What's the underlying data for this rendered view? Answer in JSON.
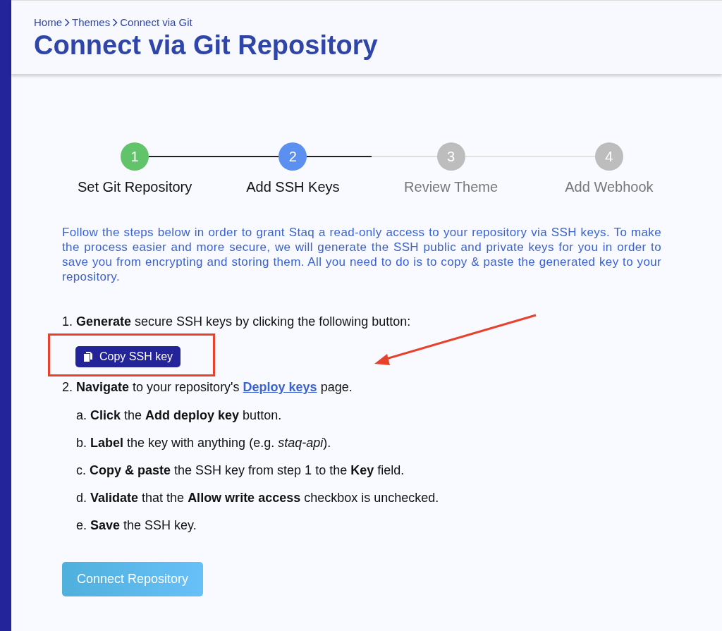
{
  "breadcrumb": [
    {
      "label": "Home"
    },
    {
      "label": "Themes"
    },
    {
      "label": "Connect via Git"
    }
  ],
  "title": "Connect via Git Repository",
  "steps": [
    {
      "number": "1",
      "label": "Set Git Repository",
      "completed": true,
      "selected": false
    },
    {
      "number": "2",
      "label": "Add SSH Keys",
      "completed": false,
      "selected": true
    },
    {
      "number": "3",
      "label": "Review Theme",
      "completed": false,
      "selected": false
    },
    {
      "number": "4",
      "label": "Add Webhook",
      "completed": false,
      "selected": false
    }
  ],
  "intro": "Follow the steps below in order to grant Staq a read-only access to your repository via SSH keys. To make the process easier and more secure, we will generate the SSH public and private keys for you in order to save you from encrypting and storing them. All you need to do is to copy & paste the generated key to your repository.",
  "instructions": [
    {
      "text": "1. **Generate** secure SSH keys by clicking the following button:",
      "button": {
        "label": "Copy SSH key",
        "highlighted": true
      }
    },
    {
      "text": "2. **Navigate** to your repository's",
      "link": {
        "label": "Deploy keys",
        "pointed_by_arrow": true
      },
      "text_after": "page.",
      "children": [
        {
          "text": "a. **Click** the **Add deploy key** button."
        },
        {
          "text": "b. **Label** the key with anything (e.g. *staq-api*)."
        },
        {
          "text": "c. **Copy & paste** the SSH key from step 1 to the **Key** field."
        },
        {
          "text": "d. **Validate** that the **Allow write access** checkbox is unchecked."
        },
        {
          "text": "e. **Save** the SSH key."
        }
      ]
    }
  ],
  "primary_button": {
    "label": "Connect Repository"
  }
}
